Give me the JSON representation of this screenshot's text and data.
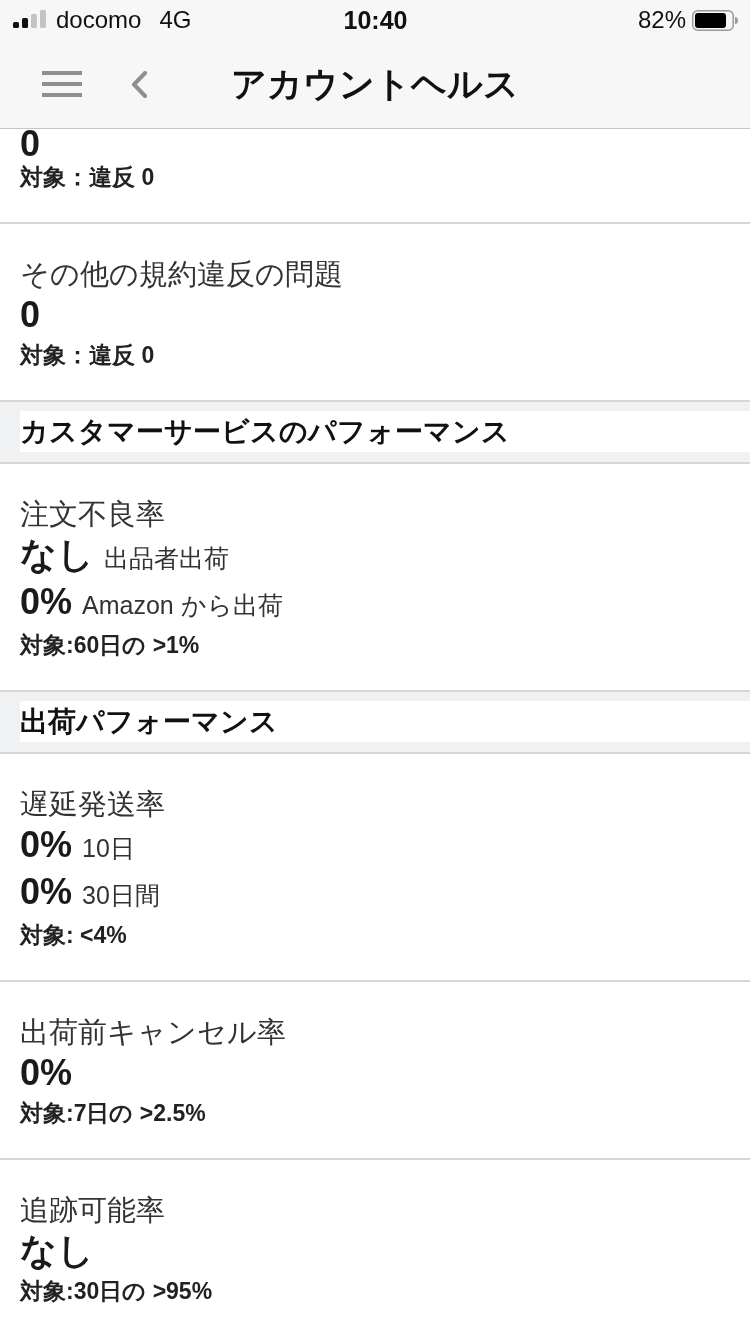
{
  "status_bar": {
    "carrier": "docomo",
    "network": "4G",
    "time": "10:40",
    "battery": "82%"
  },
  "nav_bar": {
    "title": "アカウントヘルス"
  },
  "sections": [
    {
      "items": [
        {
          "values": [
            {
              "value": "0"
            }
          ],
          "target": "対象：違反 0"
        },
        {
          "title": "その他の規約違反の問題",
          "values": [
            {
              "value": "0"
            }
          ],
          "target": "対象：違反 0"
        }
      ]
    },
    {
      "heading": "カスタマーサービスのパフォーマンス",
      "items": [
        {
          "title": "注文不良率",
          "values": [
            {
              "value": "なし",
              "note": "出品者出荷"
            },
            {
              "value": "0%",
              "note": "Amazon から出荷"
            }
          ],
          "target": "対象:60日の >1%"
        }
      ]
    },
    {
      "heading": "出荷パフォーマンス",
      "items": [
        {
          "title": "遅延発送率",
          "values": [
            {
              "value": "0%",
              "note": "10日"
            },
            {
              "value": "0%",
              "note": "30日間"
            }
          ],
          "target": "対象: <4%"
        },
        {
          "title": "出荷前キャンセル率",
          "values": [
            {
              "value": "0%"
            }
          ],
          "target": "対象:7日の >2.5%"
        },
        {
          "title": "追跡可能率",
          "values": [
            {
              "value": "なし"
            }
          ],
          "target": "対象:30日の >95%"
        }
      ]
    }
  ]
}
